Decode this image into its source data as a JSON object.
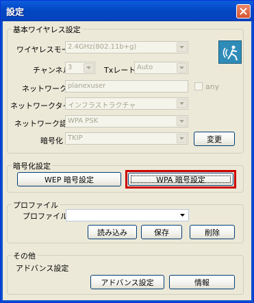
{
  "window": {
    "title": "設定"
  },
  "basic": {
    "group_label": "基本ワイヤレス設定",
    "wireless_mode_label": "ワイヤレスモード",
    "wireless_mode_value": "2.4GHz(802.11b+g)",
    "channel_label": "チャンネル",
    "channel_value": "3",
    "tx_rate_label": "Txレート",
    "tx_rate_value": "Auto",
    "network_name_label": "ネットワーク名",
    "network_name_value": "planexuser",
    "any_label": "any",
    "network_type_label": "ネットワークタイプ",
    "network_type_value": "インフラストラクチャ",
    "network_auth_label": "ネットワーク認証",
    "network_auth_value": "WPA PSK",
    "encryption_label": "暗号化",
    "encryption_value": "TKIP",
    "change_button": "変更"
  },
  "encryption_settings": {
    "group_label": "暗号化設定",
    "wep_button": "WEP 暗号設定",
    "wpa_button": "WPA 暗号設定"
  },
  "profile": {
    "group_label": "プロファイル",
    "profile_name_label": "プロファイル名",
    "profile_name_value": "",
    "load_button": "読み込み",
    "save_button": "保存",
    "delete_button": "削除"
  },
  "other": {
    "group_label": "その他",
    "advanced_label": "アドバンス設定",
    "advanced_button": "アドバンス設定",
    "info_button": "情報"
  },
  "colors": {
    "titlebar": "#0346c0",
    "highlight": "#cc0000",
    "logo": "#2f8cb8"
  },
  "icons": [
    "close-icon",
    "chevron-down-icon",
    "wireless-logo-icon"
  ]
}
